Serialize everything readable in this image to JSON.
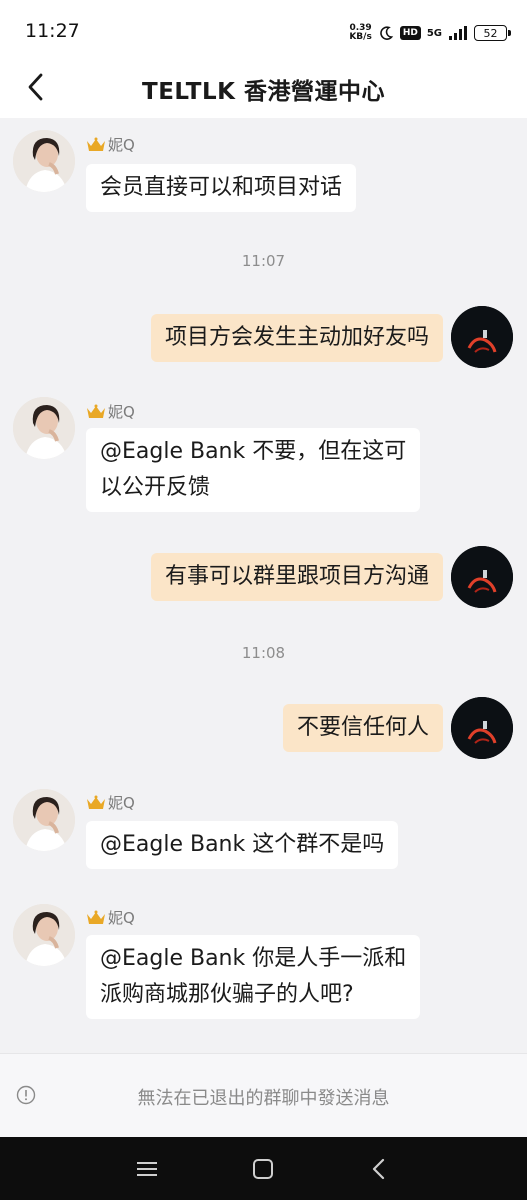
{
  "status_bar": {
    "time": "11:27",
    "net_speed_value": "0.39",
    "net_speed_unit": "KB/s",
    "hd": "HD",
    "signal": "5G",
    "battery": "52"
  },
  "header": {
    "title": "TELTLK 香港營運中心"
  },
  "messages": [
    {
      "sender": "妮Q",
      "text": "会员直接可以和项目对话"
    },
    {
      "timestamp": "11:07"
    },
    {
      "text": "项目方会发生主动加好友吗"
    },
    {
      "sender": "妮Q",
      "line1": "@Eagle Bank 不要，但在这可",
      "line2": "以公开反馈"
    },
    {
      "text": "有事可以群里跟项目方沟通"
    },
    {
      "timestamp": "11:08"
    },
    {
      "text": "不要信任何人"
    },
    {
      "sender": "妮Q",
      "text": "@Eagle Bank 这个群不是吗"
    },
    {
      "sender": "妮Q",
      "line1": "@Eagle Bank 你是人手一派和",
      "line2": "派购商城那伙骗子的人吧?"
    }
  ],
  "footer": {
    "notice": "無法在已退出的群聊中發送消息"
  },
  "icons": {
    "back": "chevron-left-icon",
    "crown": "crown-icon",
    "info": "info-icon",
    "menu": "menu-icon",
    "home": "home-icon",
    "back_nav": "back-icon"
  },
  "colors": {
    "own_bubble": "#fbe5c8",
    "other_bubble": "#ffffff",
    "chat_background": "#f2f2f4"
  }
}
